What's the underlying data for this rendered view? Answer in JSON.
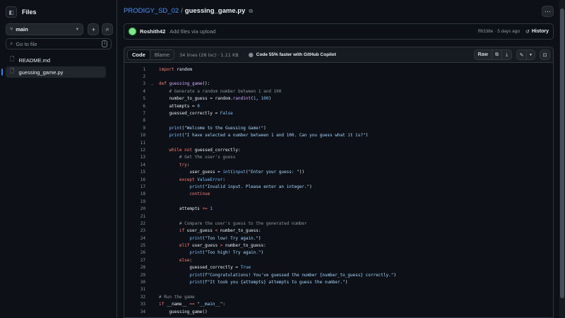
{
  "sidebar": {
    "title": "Files",
    "branch": "main",
    "goto_placeholder": "Go to file",
    "goto_shortcut": "t",
    "files": [
      {
        "name": "README.md"
      },
      {
        "name": "guessing_game.py"
      }
    ]
  },
  "header": {
    "repo": "PRODIGY_SD_02",
    "separator": "/",
    "file": "guessing_game.py"
  },
  "commit": {
    "author": "Roshith42",
    "message": "Add files via upload",
    "meta": "ff6338e · 5 days ago",
    "history_label": "History"
  },
  "file_toolbar": {
    "tab_code": "Code",
    "tab_blame": "Blame",
    "info": "34 lines (28 loc) · 1.11 KB",
    "copilot": "Code 55% faster with GitHub Copilot",
    "raw_label": "Raw"
  },
  "code_lines": [
    [
      {
        "t": "import",
        "c": "kw"
      },
      {
        "t": " random"
      }
    ],
    [],
    [
      {
        "t": "def",
        "c": "kw"
      },
      {
        "t": " "
      },
      {
        "t": "guessing_game",
        "c": "fn"
      },
      {
        "t": "():"
      }
    ],
    [
      {
        "t": "    "
      },
      {
        "t": "# Generate a random number between 1 and 100",
        "c": "cm"
      }
    ],
    [
      {
        "t": "    number_to_guess = random."
      },
      {
        "t": "randint",
        "c": "fn"
      },
      {
        "t": "("
      },
      {
        "t": "1",
        "c": "nm"
      },
      {
        "t": ", "
      },
      {
        "t": "100",
        "c": "nm"
      },
      {
        "t": ")"
      }
    ],
    [
      {
        "t": "    attempts = "
      },
      {
        "t": "0",
        "c": "nm"
      }
    ],
    [
      {
        "t": "    guessed_correctly = "
      },
      {
        "t": "False",
        "c": "nm"
      }
    ],
    [],
    [
      {
        "t": "    "
      },
      {
        "t": "print",
        "c": "nm"
      },
      {
        "t": "("
      },
      {
        "t": "\"Welcome to the Guessing Game!\"",
        "c": "st"
      },
      {
        "t": ")"
      }
    ],
    [
      {
        "t": "    "
      },
      {
        "t": "print",
        "c": "nm"
      },
      {
        "t": "("
      },
      {
        "t": "\"I have selected a number between 1 and 100. Can you guess what it is?\"",
        "c": "st"
      },
      {
        "t": ")"
      }
    ],
    [],
    [
      {
        "t": "    "
      },
      {
        "t": "while",
        "c": "kw"
      },
      {
        "t": " "
      },
      {
        "t": "not",
        "c": "kw"
      },
      {
        "t": " guessed_correctly:"
      }
    ],
    [
      {
        "t": "        "
      },
      {
        "t": "# Get the user's guess",
        "c": "cm"
      }
    ],
    [
      {
        "t": "        "
      },
      {
        "t": "try",
        "c": "kw"
      },
      {
        "t": ":"
      }
    ],
    [
      {
        "t": "            user_guess = "
      },
      {
        "t": "int",
        "c": "nm"
      },
      {
        "t": "("
      },
      {
        "t": "input",
        "c": "nm"
      },
      {
        "t": "("
      },
      {
        "t": "\"Enter your guess: \"",
        "c": "st"
      },
      {
        "t": "))"
      }
    ],
    [
      {
        "t": "        "
      },
      {
        "t": "except",
        "c": "kw"
      },
      {
        "t": " "
      },
      {
        "t": "ValueError",
        "c": "nm"
      },
      {
        "t": ":"
      }
    ],
    [
      {
        "t": "            "
      },
      {
        "t": "print",
        "c": "nm"
      },
      {
        "t": "("
      },
      {
        "t": "\"Invalid input. Please enter an integer.\"",
        "c": "st"
      },
      {
        "t": ")"
      }
    ],
    [
      {
        "t": "            "
      },
      {
        "t": "continue",
        "c": "kw"
      }
    ],
    [],
    [
      {
        "t": "        attempts "
      },
      {
        "t": "+=",
        "c": "kw"
      },
      {
        "t": " "
      },
      {
        "t": "1",
        "c": "nm"
      }
    ],
    [],
    [
      {
        "t": "        "
      },
      {
        "t": "# Compare the user's guess to the generated number",
        "c": "cm"
      }
    ],
    [
      {
        "t": "        "
      },
      {
        "t": "if",
        "c": "kw"
      },
      {
        "t": " user_guess "
      },
      {
        "t": "<",
        "c": "kw"
      },
      {
        "t": " number_to_guess:"
      }
    ],
    [
      {
        "t": "            "
      },
      {
        "t": "print",
        "c": "nm"
      },
      {
        "t": "("
      },
      {
        "t": "\"Too low! Try again.\"",
        "c": "st"
      },
      {
        "t": ")"
      }
    ],
    [
      {
        "t": "        "
      },
      {
        "t": "elif",
        "c": "kw"
      },
      {
        "t": " user_guess "
      },
      {
        "t": ">",
        "c": "kw"
      },
      {
        "t": " number_to_guess:"
      }
    ],
    [
      {
        "t": "            "
      },
      {
        "t": "print",
        "c": "nm"
      },
      {
        "t": "("
      },
      {
        "t": "\"Too high! Try again.\"",
        "c": "st"
      },
      {
        "t": ")"
      }
    ],
    [
      {
        "t": "        "
      },
      {
        "t": "else",
        "c": "kw"
      },
      {
        "t": ":"
      }
    ],
    [
      {
        "t": "            guessed_correctly = "
      },
      {
        "t": "True",
        "c": "nm"
      }
    ],
    [
      {
        "t": "            "
      },
      {
        "t": "print",
        "c": "nm"
      },
      {
        "t": "("
      },
      {
        "t": "f\"Congratulations! You've guessed the number {number_to_guess} correctly.\"",
        "c": "st"
      },
      {
        "t": ")"
      }
    ],
    [
      {
        "t": "            "
      },
      {
        "t": "print",
        "c": "nm"
      },
      {
        "t": "("
      },
      {
        "t": "f\"It took you {attempts} attempts to guess the number.\"",
        "c": "st"
      },
      {
        "t": ")"
      }
    ],
    [],
    [
      {
        "t": "# Run the game",
        "c": "cm"
      }
    ],
    [
      {
        "t": "if",
        "c": "kw"
      },
      {
        "t": " __name__ "
      },
      {
        "t": "==",
        "c": "kw"
      },
      {
        "t": " "
      },
      {
        "t": "\"__main__\"",
        "c": "st"
      },
      {
        "t": ":"
      }
    ],
    [
      {
        "t": "    guessing_game()"
      }
    ]
  ],
  "fold_lines": [
    3
  ],
  "icons": {
    "sidebar_toggle": "sidebar-collapse-icon",
    "branch": "git-branch-icon",
    "plus": "plus-icon",
    "search": "search-icon",
    "file": "file-icon",
    "copy": "copy-icon",
    "more": "kebab-horizontal-icon",
    "history": "history-icon",
    "copilot": "copilot-icon",
    "download": "download-icon",
    "edit": "pencil-icon",
    "symbols": "code-square-icon"
  },
  "colors": {
    "background": "#0d1117",
    "border": "#30363d",
    "link": "#4493f8",
    "keyword": "#ff7b72",
    "function": "#d2a8ff",
    "string": "#a5d6ff",
    "constant": "#79c0ff",
    "comment": "#8b949e"
  }
}
